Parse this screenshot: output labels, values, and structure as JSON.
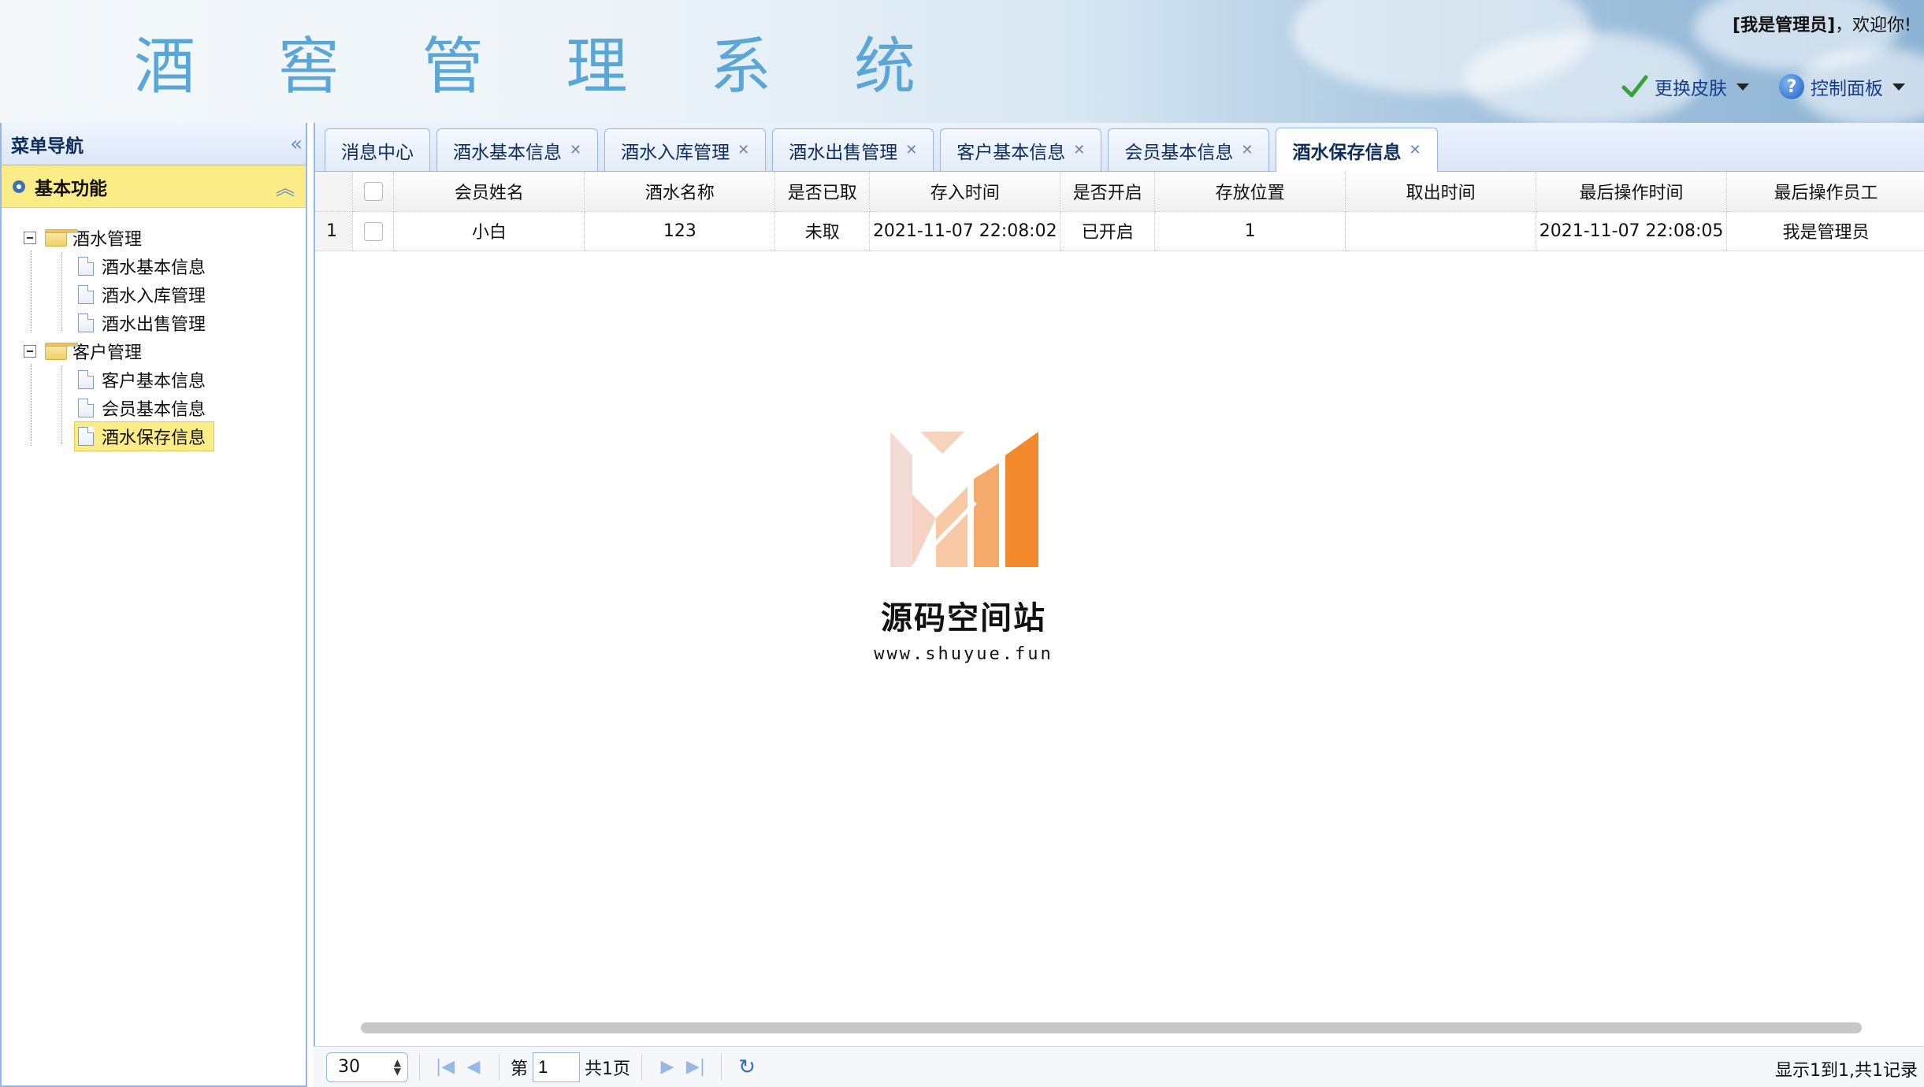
{
  "header": {
    "title": "酒 窖 管 理 系 统",
    "welcome_user": "[我是管理员]",
    "welcome_suffix": "，欢迎你!",
    "skin_label": "更换皮肤",
    "control_panel_label": "控制面板"
  },
  "sidebar": {
    "title": "菜单导航",
    "section_title": "基本功能",
    "groups": [
      {
        "label": "酒水管理",
        "items": [
          "酒水基本信息",
          "酒水入库管理",
          "酒水出售管理"
        ]
      },
      {
        "label": "客户管理",
        "items": [
          "客户基本信息",
          "会员基本信息",
          "酒水保存信息"
        ]
      }
    ],
    "selected_item": "酒水保存信息"
  },
  "tabs": [
    {
      "label": "消息中心",
      "closable": false
    },
    {
      "label": "酒水基本信息",
      "closable": true
    },
    {
      "label": "酒水入库管理",
      "closable": true
    },
    {
      "label": "酒水出售管理",
      "closable": true
    },
    {
      "label": "客户基本信息",
      "closable": true
    },
    {
      "label": "会员基本信息",
      "closable": true
    },
    {
      "label": "酒水保存信息",
      "closable": true,
      "active": true
    }
  ],
  "table": {
    "columns": [
      "会员姓名",
      "酒水名称",
      "是否已取",
      "存入时间",
      "是否开启",
      "存放位置",
      "取出时间",
      "最后操作时间",
      "最后操作员工"
    ],
    "rows": [
      {
        "num": "1",
        "cells": [
          "小白",
          "123",
          "未取",
          "2021-11-07 22:08:02",
          "已开启",
          "1",
          "",
          "2021-11-07 22:08:05",
          "我是管理员"
        ]
      }
    ]
  },
  "watermark": {
    "name": "源码空间站",
    "url": "www.shuyue.fun"
  },
  "pager": {
    "page_size": "30",
    "page_prefix": "第",
    "page_value": "1",
    "page_total": "共1页",
    "record_info": "显示1到1,共1记录"
  },
  "colors": {
    "accent": "#95b8e7",
    "selected": "#fbec88",
    "title_blue": "#5aa6d6"
  }
}
